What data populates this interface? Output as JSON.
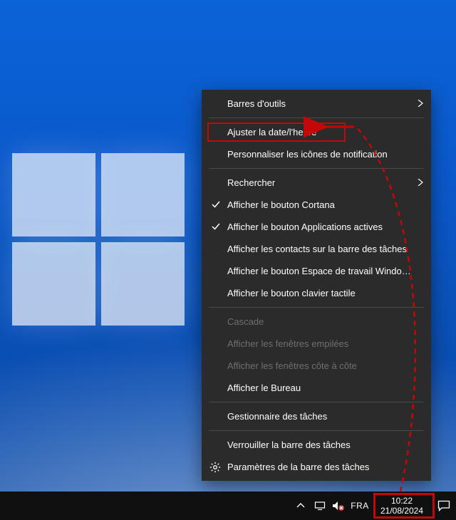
{
  "colors": {
    "annotation": "#c40808",
    "menu_bg": "#2b2b2b",
    "taskbar_bg": "#101010"
  },
  "menu": {
    "items": [
      {
        "label": "Barres d'outils",
        "submenu": true
      },
      {
        "label": "Ajuster la date/l'heure",
        "highlighted": true
      },
      {
        "label": "Personnaliser les icônes de notification"
      },
      {
        "label": "Rechercher",
        "submenu": true
      },
      {
        "label": "Afficher le bouton Cortana",
        "checked": true
      },
      {
        "label": "Afficher le bouton Applications actives",
        "checked": true
      },
      {
        "label": "Afficher les contacts sur la barre des tâches"
      },
      {
        "label": "Afficher le bouton Espace de travail Windows Ink"
      },
      {
        "label": "Afficher le bouton clavier tactile"
      },
      {
        "label": "Cascade",
        "disabled": true
      },
      {
        "label": "Afficher les fenêtres empilées",
        "disabled": true
      },
      {
        "label": "Afficher les fenêtres côte à côte",
        "disabled": true
      },
      {
        "label": "Afficher le Bureau"
      },
      {
        "label": "Gestionnaire des tâches"
      },
      {
        "label": "Verrouiller la barre des tâches"
      },
      {
        "label": "Paramètres de la barre des tâches",
        "gear": true
      }
    ]
  },
  "taskbar": {
    "language": "FRA",
    "time": "10:22",
    "date": "21/08/2024"
  }
}
